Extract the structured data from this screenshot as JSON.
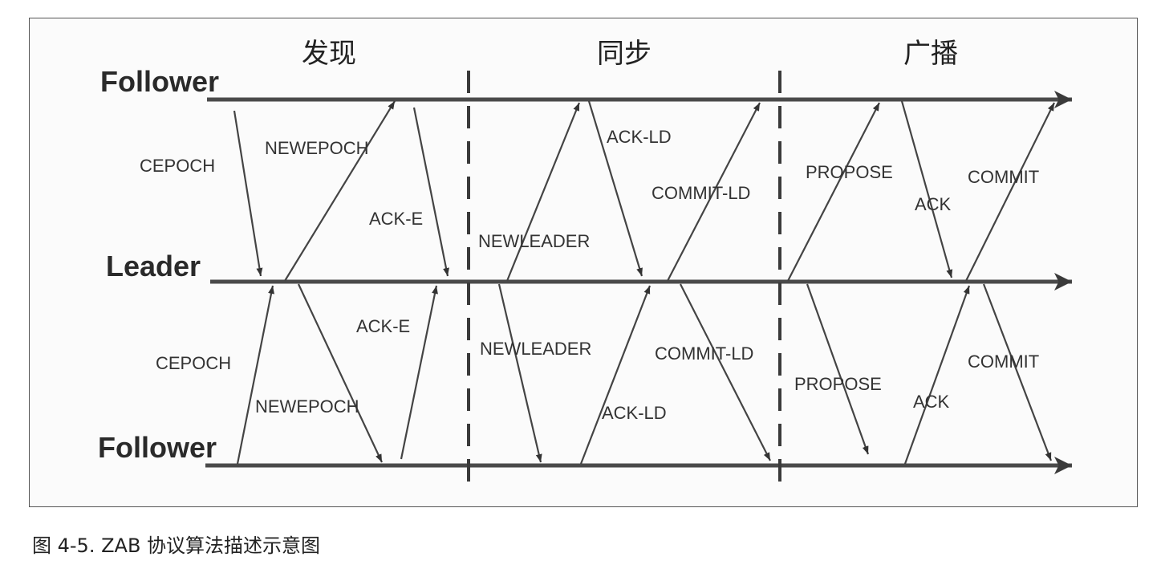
{
  "phases": [
    "发现",
    "同步",
    "广播"
  ],
  "roles": {
    "top": "Follower",
    "middle": "Leader",
    "bottom": "Follower"
  },
  "messages": {
    "d_top_cepoch": "CEPOCH",
    "d_top_newepoch": "NEWEPOCH",
    "d_top_acke": "ACK-E",
    "d_bot_cepoch": "CEPOCH",
    "d_bot_newepoch": "NEWEPOCH",
    "d_bot_acke": "ACK-E",
    "s_top_newleader": "NEWLEADER",
    "s_top_ackld": "ACK-LD",
    "s_top_commitld": "COMMIT-LD",
    "s_bot_newleader": "NEWLEADER",
    "s_bot_ackld": "ACK-LD",
    "s_bot_commitld": "COMMIT-LD",
    "b_top_propose": "PROPOSE",
    "b_top_ack": "ACK",
    "b_top_commit": "COMMIT",
    "b_bot_propose": "PROPOSE",
    "b_bot_ack": "ACK",
    "b_bot_commit": "COMMIT"
  },
  "caption": "图 4-5.  ZAB 协议算法描述示意图"
}
